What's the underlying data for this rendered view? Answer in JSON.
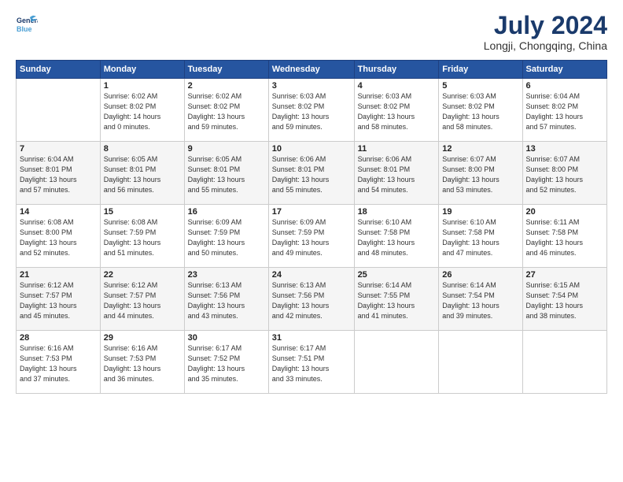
{
  "header": {
    "logo_line1": "General",
    "logo_line2": "Blue",
    "title": "July 2024",
    "subtitle": "Longji, Chongqing, China"
  },
  "calendar": {
    "columns": [
      "Sunday",
      "Monday",
      "Tuesday",
      "Wednesday",
      "Thursday",
      "Friday",
      "Saturday"
    ],
    "weeks": [
      [
        {
          "day": "",
          "info": ""
        },
        {
          "day": "1",
          "info": "Sunrise: 6:02 AM\nSunset: 8:02 PM\nDaylight: 14 hours\nand 0 minutes."
        },
        {
          "day": "2",
          "info": "Sunrise: 6:02 AM\nSunset: 8:02 PM\nDaylight: 13 hours\nand 59 minutes."
        },
        {
          "day": "3",
          "info": "Sunrise: 6:03 AM\nSunset: 8:02 PM\nDaylight: 13 hours\nand 59 minutes."
        },
        {
          "day": "4",
          "info": "Sunrise: 6:03 AM\nSunset: 8:02 PM\nDaylight: 13 hours\nand 58 minutes."
        },
        {
          "day": "5",
          "info": "Sunrise: 6:03 AM\nSunset: 8:02 PM\nDaylight: 13 hours\nand 58 minutes."
        },
        {
          "day": "6",
          "info": "Sunrise: 6:04 AM\nSunset: 8:02 PM\nDaylight: 13 hours\nand 57 minutes."
        }
      ],
      [
        {
          "day": "7",
          "info": "Sunrise: 6:04 AM\nSunset: 8:01 PM\nDaylight: 13 hours\nand 57 minutes."
        },
        {
          "day": "8",
          "info": "Sunrise: 6:05 AM\nSunset: 8:01 PM\nDaylight: 13 hours\nand 56 minutes."
        },
        {
          "day": "9",
          "info": "Sunrise: 6:05 AM\nSunset: 8:01 PM\nDaylight: 13 hours\nand 55 minutes."
        },
        {
          "day": "10",
          "info": "Sunrise: 6:06 AM\nSunset: 8:01 PM\nDaylight: 13 hours\nand 55 minutes."
        },
        {
          "day": "11",
          "info": "Sunrise: 6:06 AM\nSunset: 8:01 PM\nDaylight: 13 hours\nand 54 minutes."
        },
        {
          "day": "12",
          "info": "Sunrise: 6:07 AM\nSunset: 8:00 PM\nDaylight: 13 hours\nand 53 minutes."
        },
        {
          "day": "13",
          "info": "Sunrise: 6:07 AM\nSunset: 8:00 PM\nDaylight: 13 hours\nand 52 minutes."
        }
      ],
      [
        {
          "day": "14",
          "info": "Sunrise: 6:08 AM\nSunset: 8:00 PM\nDaylight: 13 hours\nand 52 minutes."
        },
        {
          "day": "15",
          "info": "Sunrise: 6:08 AM\nSunset: 7:59 PM\nDaylight: 13 hours\nand 51 minutes."
        },
        {
          "day": "16",
          "info": "Sunrise: 6:09 AM\nSunset: 7:59 PM\nDaylight: 13 hours\nand 50 minutes."
        },
        {
          "day": "17",
          "info": "Sunrise: 6:09 AM\nSunset: 7:59 PM\nDaylight: 13 hours\nand 49 minutes."
        },
        {
          "day": "18",
          "info": "Sunrise: 6:10 AM\nSunset: 7:58 PM\nDaylight: 13 hours\nand 48 minutes."
        },
        {
          "day": "19",
          "info": "Sunrise: 6:10 AM\nSunset: 7:58 PM\nDaylight: 13 hours\nand 47 minutes."
        },
        {
          "day": "20",
          "info": "Sunrise: 6:11 AM\nSunset: 7:58 PM\nDaylight: 13 hours\nand 46 minutes."
        }
      ],
      [
        {
          "day": "21",
          "info": "Sunrise: 6:12 AM\nSunset: 7:57 PM\nDaylight: 13 hours\nand 45 minutes."
        },
        {
          "day": "22",
          "info": "Sunrise: 6:12 AM\nSunset: 7:57 PM\nDaylight: 13 hours\nand 44 minutes."
        },
        {
          "day": "23",
          "info": "Sunrise: 6:13 AM\nSunset: 7:56 PM\nDaylight: 13 hours\nand 43 minutes."
        },
        {
          "day": "24",
          "info": "Sunrise: 6:13 AM\nSunset: 7:56 PM\nDaylight: 13 hours\nand 42 minutes."
        },
        {
          "day": "25",
          "info": "Sunrise: 6:14 AM\nSunset: 7:55 PM\nDaylight: 13 hours\nand 41 minutes."
        },
        {
          "day": "26",
          "info": "Sunrise: 6:14 AM\nSunset: 7:54 PM\nDaylight: 13 hours\nand 39 minutes."
        },
        {
          "day": "27",
          "info": "Sunrise: 6:15 AM\nSunset: 7:54 PM\nDaylight: 13 hours\nand 38 minutes."
        }
      ],
      [
        {
          "day": "28",
          "info": "Sunrise: 6:16 AM\nSunset: 7:53 PM\nDaylight: 13 hours\nand 37 minutes."
        },
        {
          "day": "29",
          "info": "Sunrise: 6:16 AM\nSunset: 7:53 PM\nDaylight: 13 hours\nand 36 minutes."
        },
        {
          "day": "30",
          "info": "Sunrise: 6:17 AM\nSunset: 7:52 PM\nDaylight: 13 hours\nand 35 minutes."
        },
        {
          "day": "31",
          "info": "Sunrise: 6:17 AM\nSunset: 7:51 PM\nDaylight: 13 hours\nand 33 minutes."
        },
        {
          "day": "",
          "info": ""
        },
        {
          "day": "",
          "info": ""
        },
        {
          "day": "",
          "info": ""
        }
      ]
    ]
  }
}
